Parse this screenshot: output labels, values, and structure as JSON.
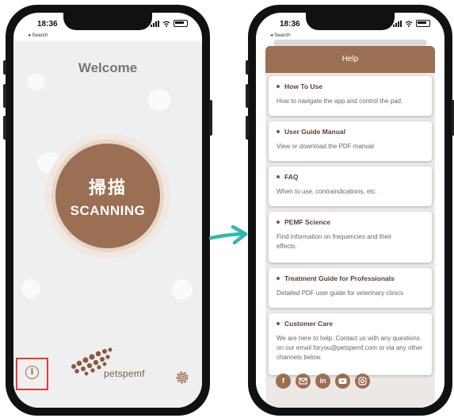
{
  "status": {
    "time": "18:36",
    "back_label": "◂ Search"
  },
  "left_screen": {
    "title": "Welcome",
    "scan_button": {
      "label_cn": "掃描",
      "label_en": "SCANNING"
    },
    "logo_text": "petspemf"
  },
  "right_screen": {
    "header_title": "Help",
    "items": [
      {
        "title": "How To Use",
        "description": "How to navigate the app and control the pad."
      },
      {
        "title": "User Guide Manual",
        "description": "View or download the PDF manual"
      },
      {
        "title": "FAQ",
        "description": "When to use, contraindications, etc."
      },
      {
        "title": "PEMF Science",
        "description": "Find information on frequencies and their effects."
      },
      {
        "title": "Treatment Guide for Professionals",
        "description": "Detailed PDF user guide for veterinary clinics"
      },
      {
        "title": "Customer Care",
        "description": "We are here to help. Contact us with any questions on our email foryou@petspemf.com or via any other channels below."
      }
    ],
    "social_icons": [
      "facebook-icon",
      "email-icon",
      "linkedin-icon",
      "youtube-icon",
      "instagram-icon"
    ]
  },
  "colors": {
    "brand_brown": "#9b6f53",
    "highlight_red": "#e53935",
    "arrow_teal": "#2fb8b0"
  }
}
